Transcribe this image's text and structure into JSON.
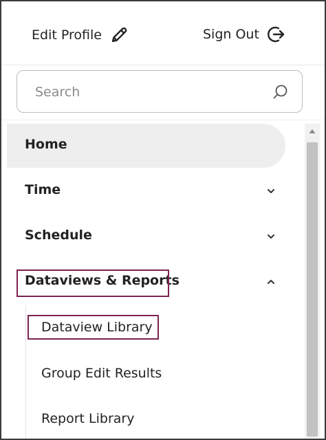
{
  "header": {
    "edit_profile_label": "Edit Profile",
    "sign_out_label": "Sign Out"
  },
  "search": {
    "placeholder": "Search"
  },
  "nav": {
    "items": [
      {
        "label": "Home"
      },
      {
        "label": "Time"
      },
      {
        "label": "Schedule"
      },
      {
        "label": "Dataviews & Reports"
      }
    ],
    "subitems": [
      {
        "label": "Dataview Library"
      },
      {
        "label": "Group Edit Results"
      },
      {
        "label": "Report Library"
      }
    ]
  },
  "colors": {
    "highlight_border": "#7b2250",
    "active_background": "#eeeeee"
  },
  "icons": [
    "pencil-icon",
    "sign-out-icon",
    "search-icon",
    "chevron-down-icon",
    "chevron-up-icon",
    "scroll-up-arrow-icon"
  ]
}
